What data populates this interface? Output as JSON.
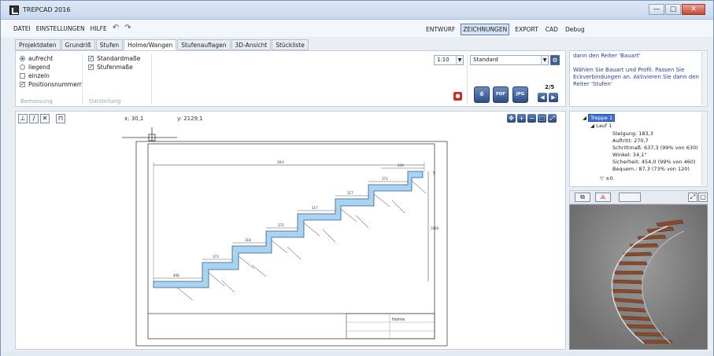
{
  "app": {
    "title": "TREPCAD 2016"
  },
  "window_buttons": {
    "minimize": "—",
    "maximize": "▢",
    "close": "✕"
  },
  "menu": {
    "left": [
      "DATEI",
      "EINSTELLUNGEN",
      "HILFE"
    ],
    "undo": "↶",
    "redo": "↷",
    "right": [
      "ENTWURF",
      "ZEICHNUNGEN",
      "EXPORT",
      "CAD",
      "Debug"
    ],
    "active_mode": "ZEICHNUNGEN"
  },
  "tabs": [
    "Projektdaten",
    "Grundriß",
    "Stufen",
    "Holme/Wangen",
    "Stufenauflagen",
    "3D-Ansicht",
    "Stückliste"
  ],
  "active_tab": "Holme/Wangen",
  "bemassung": {
    "options": [
      {
        "label": "aufrecht",
        "type": "radio",
        "checked": true
      },
      {
        "label": "liegend",
        "type": "radio",
        "checked": false
      },
      {
        "label": "einzeln",
        "type": "check",
        "checked": false
      },
      {
        "label": "Positionsnummern",
        "type": "check",
        "checked": true
      }
    ],
    "group_label": "Bemassung"
  },
  "darstellung": {
    "options": [
      {
        "label": "Standardmaße",
        "checked": true
      },
      {
        "label": "Stufenmaße",
        "checked": true
      }
    ],
    "group_label": "Darstellung"
  },
  "scale_select": {
    "value": "1:10"
  },
  "style_select": {
    "value": "Standard"
  },
  "export": {
    "print_label": "⎙",
    "pdf_label": "PDF",
    "jpg_label": "JPG"
  },
  "pagination": {
    "page": "2/5",
    "prev": "◀",
    "next": "▶"
  },
  "info_text": {
    "line1": "dann den Reiter 'Bauart'",
    "line2": "Wählen Sie Bauart und Profil. Passen Sie Eckverbindungen an. Aktivieren Sie dann den Reiter 'Stufen'"
  },
  "draw_toolbar": {
    "tools": [
      "⊥",
      "∕",
      "✕",
      "⊓"
    ],
    "x_coord": "x: 30,1",
    "y_coord": "y: 2129,1",
    "zoom": [
      "✥",
      "+",
      "−",
      "⬚",
      "⤢"
    ]
  },
  "drawing": {
    "dims": [
      "28'4",
      "359",
      "371",
      "317",
      "317",
      "272",
      "318",
      "373",
      "408",
      "1060",
      "5"
    ],
    "titleblock": {
      "name": "Holme"
    }
  },
  "tree": {
    "root": "Treppe 1",
    "child": "Lauf 1",
    "values": [
      "Steigung:   183,3",
      "Auftritt:   270,7",
      "Schrittmaß: 637,3 (99% von 630)",
      "Winkel: 34,1°",
      "Sicherheit: 454,0 (99% von 460)",
      "Bequem.: 87,3 (73% von 120)"
    ],
    "level": "±0"
  },
  "view3d_bar": {
    "btn1": "⧉",
    "btn2": "⟁",
    "btn3": "",
    "fit": "⤢"
  },
  "colors": {
    "accent": "#3b6fd1",
    "stair_fill": "#a9d3ee",
    "tread": "#8a4a2c"
  }
}
